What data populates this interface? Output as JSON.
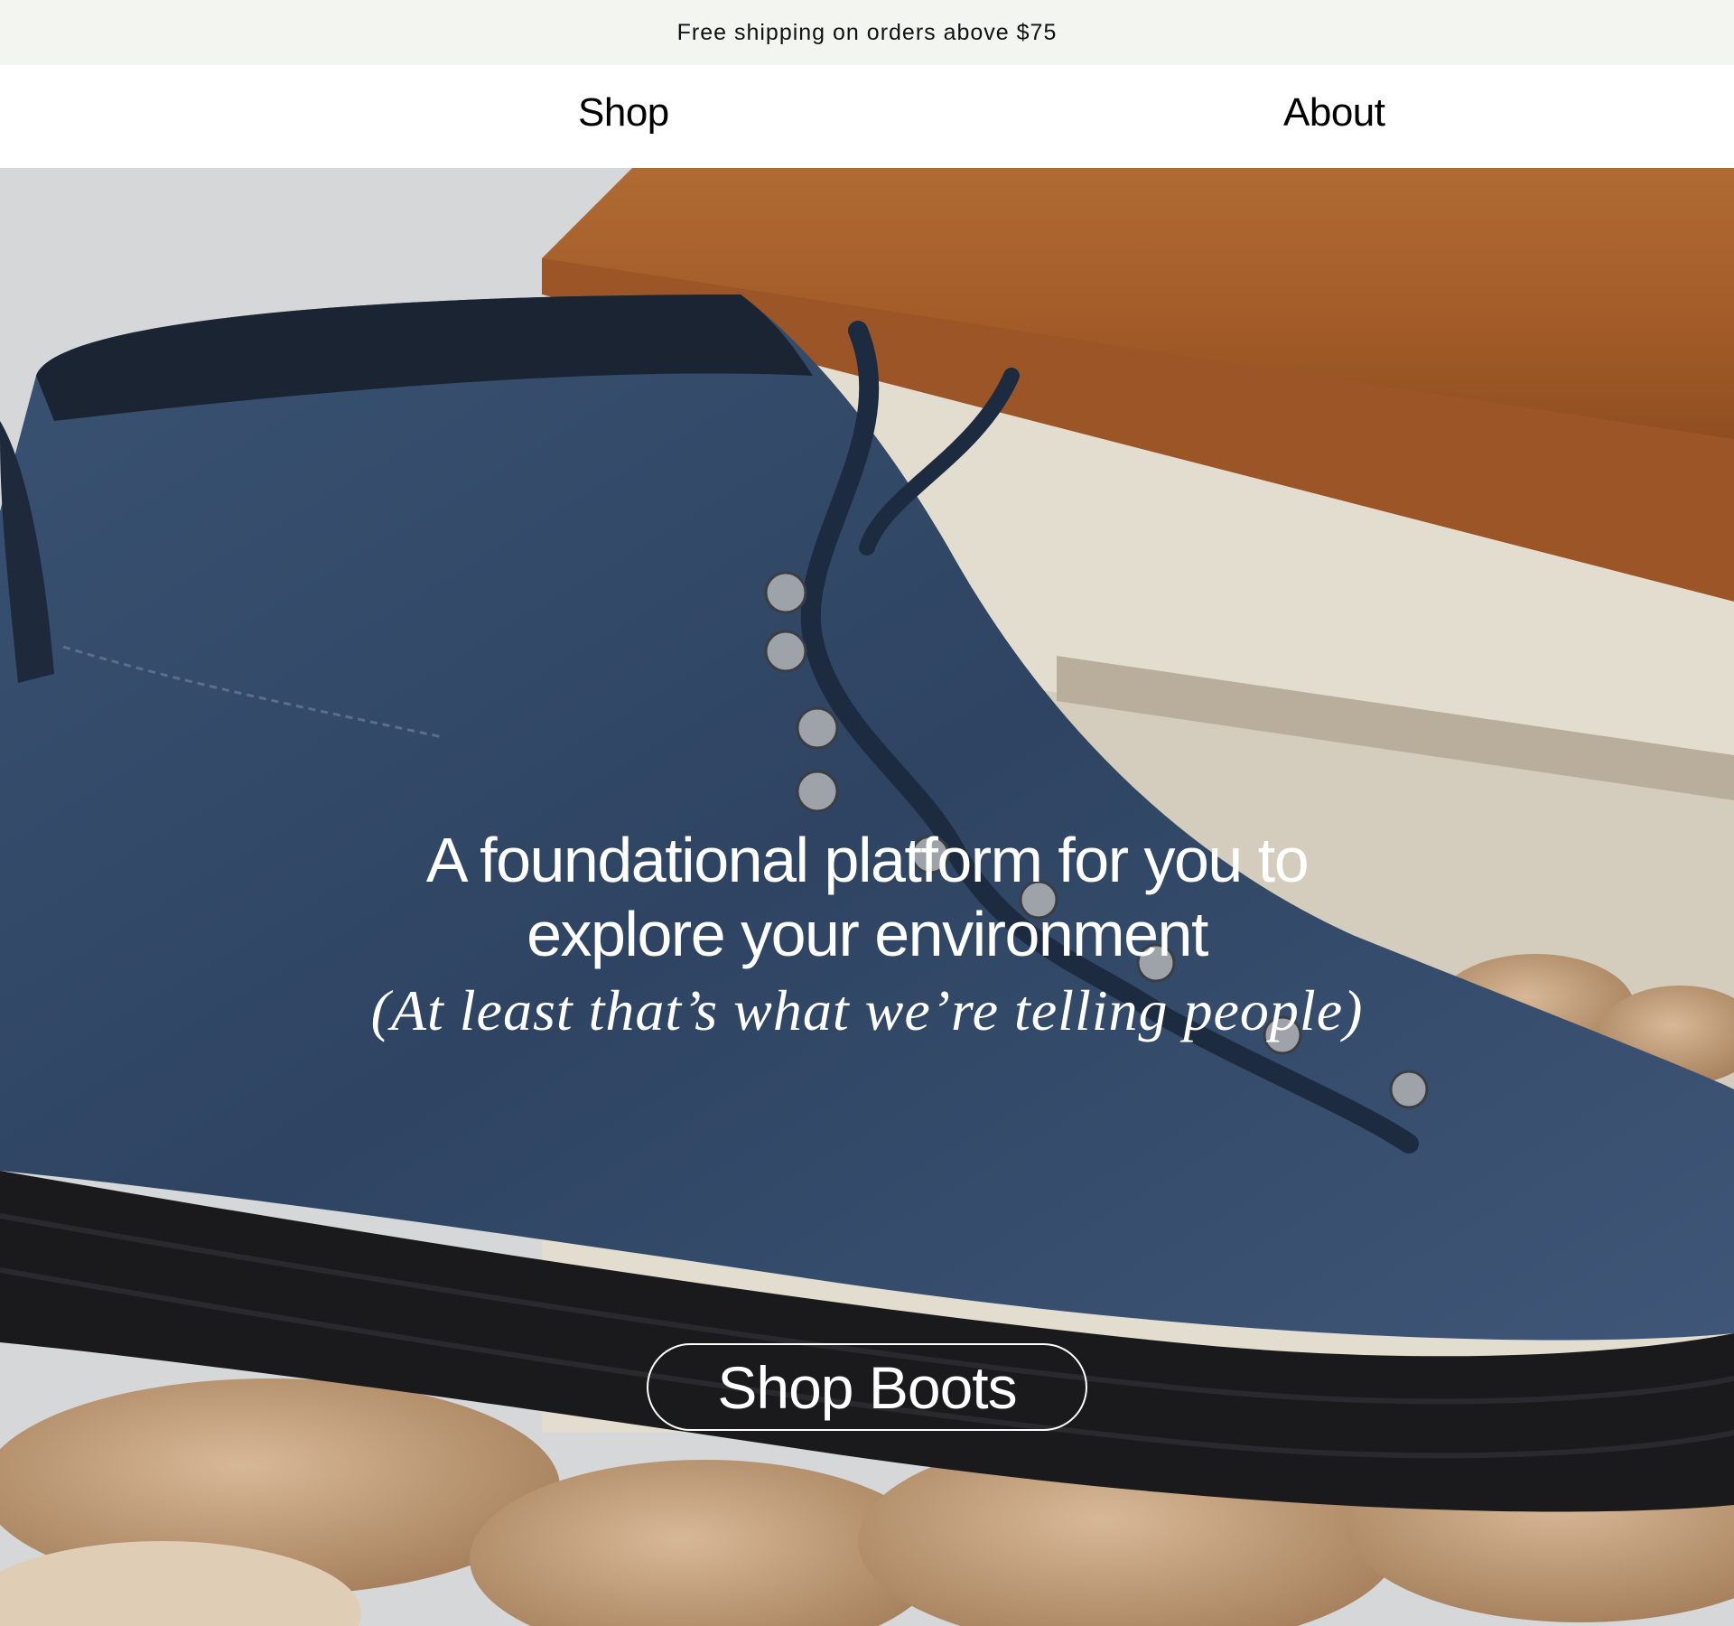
{
  "announcement": {
    "text": "Free shipping on orders above $75"
  },
  "nav": {
    "items": [
      {
        "label": "Shop"
      },
      {
        "label": "About"
      }
    ]
  },
  "hero": {
    "headline_line1": "A foundational platform for you to",
    "headline_line2": "explore your environment",
    "subheadline": "(At least that’s what we’re telling people)",
    "cta_label": "Shop Boots",
    "image": "navy suede lace-up hiking boot on rocks beside wooden bench"
  },
  "colors": {
    "announcement_bg": "#f3f5f0",
    "nav_bg": "#ffffff",
    "hero_text": "#ffffff",
    "boot": "#2e4462"
  }
}
